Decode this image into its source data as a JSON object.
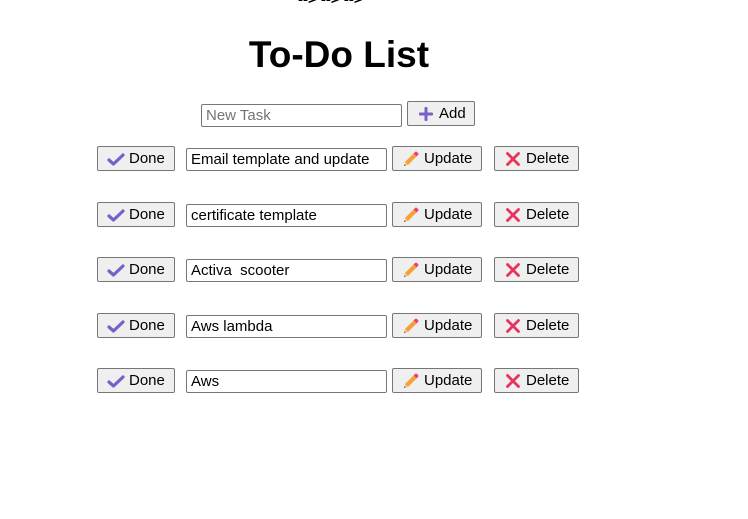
{
  "artifact_text": "--> --> -->",
  "title": "To-Do List",
  "new_task": {
    "placeholder": "New Task",
    "value": "",
    "add_label": "Add"
  },
  "tasks": [
    {
      "done_label": "Done",
      "text": "Email template and update",
      "update_label": "Update",
      "delete_label": "Delete"
    },
    {
      "done_label": "Done",
      "text": "certificate template",
      "update_label": "Update",
      "delete_label": "Delete"
    },
    {
      "done_label": "Done",
      "text": "Activa  scooter",
      "update_label": "Update",
      "delete_label": "Delete"
    },
    {
      "done_label": "Done",
      "text": "Aws lambda",
      "update_label": "Update",
      "delete_label": "Delete"
    },
    {
      "done_label": "Done",
      "text": "Aws",
      "update_label": "Update",
      "delete_label": "Delete"
    }
  ],
  "icons": {
    "add": "plus-icon",
    "done": "check-icon",
    "update": "pencil-icon",
    "delete": "cross-icon"
  },
  "colors": {
    "add_icon": "#7b5fc9",
    "done_icon": "#7b5fc9",
    "pencil_body": "#f4a13a",
    "pencil_tip": "#e8446b",
    "delete_icon": "#e8335c"
  }
}
